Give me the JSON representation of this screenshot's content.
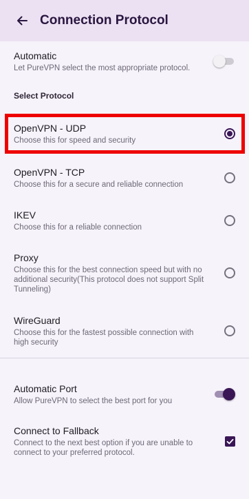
{
  "header": {
    "title": "Connection Protocol",
    "back_icon": "arrow-left-icon"
  },
  "automatic": {
    "label": "Automatic",
    "description": "Let PureVPN select the most appropriate protocol.",
    "enabled": false
  },
  "section_title": "Select Protocol",
  "protocols": [
    {
      "label": "OpenVPN - UDP",
      "description": "Choose this for speed and security",
      "selected": true
    },
    {
      "label": "OpenVPN - TCP",
      "description": "Choose this for a secure and reliable connection",
      "selected": false
    },
    {
      "label": "IKEV",
      "description": "Choose this for a reliable connection",
      "selected": false
    },
    {
      "label": "Proxy",
      "description": "Choose this for the best connection speed but with no additional security(This protocol does not support Split Tunneling)",
      "selected": false
    },
    {
      "label": "WireGuard",
      "description": "Choose this for the fastest possible connection with high security",
      "selected": false
    }
  ],
  "automatic_port": {
    "label": "Automatic Port",
    "description": "Allow PureVPN to select the best port for you",
    "enabled": true
  },
  "fallback": {
    "label": "Connect to Fallback",
    "description": "Connect to the next best option if you are unable to connect to your preferred protocol.",
    "checked": true
  },
  "colors": {
    "accent": "#3a1656",
    "header_bg": "#ebe1f2",
    "highlight": "#ee0000"
  }
}
